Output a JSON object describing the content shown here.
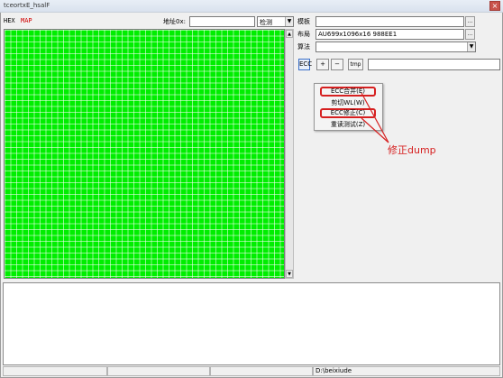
{
  "window": {
    "title": "tceortxE_hsalF",
    "close_label": "×"
  },
  "left_panel": {
    "hex_label": "HEX",
    "map_label": "MAP",
    "address_label": "地址0x:",
    "address_value": "",
    "mode_select_value": "检测",
    "map_fill_color": "#00ee00"
  },
  "right_panel": {
    "template_label": "模板",
    "template_value": "",
    "layout_label": "布局",
    "layout_value": "AU699x1096x16 988EE1",
    "algorithm_label": "算法",
    "algorithm_value": "",
    "browse_label": "...",
    "toolbar": {
      "ecc_label": "ECC",
      "plus_label": "+",
      "minus_label": "−",
      "tmp_label": "tmp",
      "field_value": ""
    }
  },
  "context_menu": {
    "items": [
      {
        "label": "ECC合并(E)",
        "highlighted": true
      },
      {
        "label": "剪切WL(W)",
        "highlighted": false
      },
      {
        "label": "ECC修正(C)",
        "highlighted": true
      },
      {
        "label": "重读测试(Z)",
        "highlighted": false
      }
    ]
  },
  "annotation": {
    "text": "修正dump",
    "color": "#d62020"
  },
  "status_bar": {
    "pane_1": "",
    "pane_2": "",
    "pane_3": "",
    "path": "D:\\beixiude"
  }
}
